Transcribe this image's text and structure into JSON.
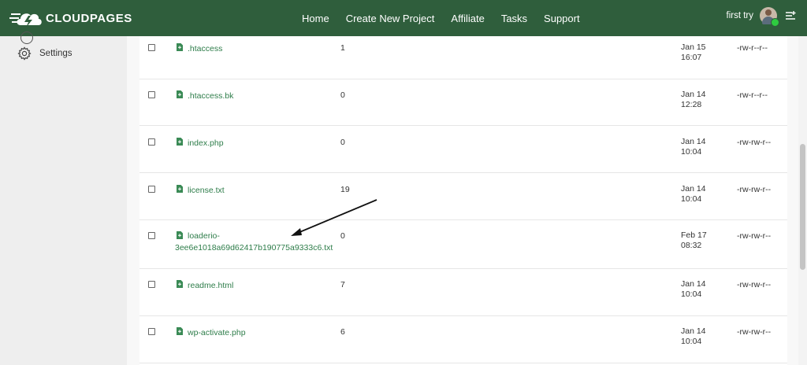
{
  "brand": {
    "name": "CLOUDPAGES"
  },
  "nav": {
    "items": [
      "Home",
      "Create New Project",
      "Affiliate",
      "Tasks",
      "Support"
    ]
  },
  "user": {
    "name": "first try"
  },
  "sidebar": {
    "settings_label": "Settings"
  },
  "files": [
    {
      "name": ".htaccess",
      "size": "1",
      "date": "Jan 15",
      "time": "16:07",
      "perm": "-rw-r--r--"
    },
    {
      "name": ".htaccess.bk",
      "size": "0",
      "date": "Jan 14",
      "time": "12:28",
      "perm": "-rw-r--r--"
    },
    {
      "name": "index.php",
      "size": "0",
      "date": "Jan 14",
      "time": "10:04",
      "perm": "-rw-rw-r--"
    },
    {
      "name": "license.txt",
      "size": "19",
      "date": "Jan 14",
      "time": "10:04",
      "perm": "-rw-rw-r--"
    },
    {
      "name_line1": "loaderio-",
      "name_line2": "3ee6e1018a69d62417b190775a9333c6.txt",
      "size": "0",
      "date": "Feb 17",
      "time": "08:32",
      "perm": "-rw-rw-r--"
    },
    {
      "name": "readme.html",
      "size": "7",
      "date": "Jan 14",
      "time": "10:04",
      "perm": "-rw-rw-r--"
    },
    {
      "name": "wp-activate.php",
      "size": "6",
      "date": "Jan 14",
      "time": "10:04",
      "perm": "-rw-rw-r--"
    }
  ],
  "colors": {
    "header": "#2f5e3c",
    "link": "#2e7d4a",
    "sidebar": "#eeeeee"
  }
}
